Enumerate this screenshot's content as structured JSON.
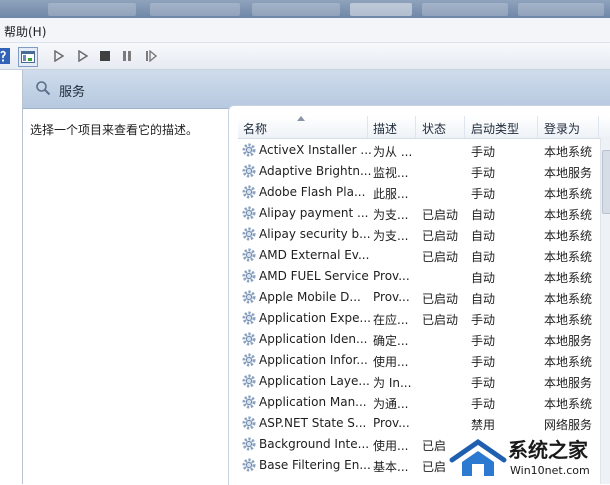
{
  "menu": {
    "help": "帮助(H)"
  },
  "header": {
    "title": "服务"
  },
  "description": "选择一个项目来查看它的描述。",
  "columns": [
    "名称",
    "描述",
    "状态",
    "启动类型",
    "登录为"
  ],
  "services": [
    {
      "name": "ActiveX Installer ...",
      "desc": "为从 ...",
      "status": "",
      "startup": "手动",
      "logon": "本地系统"
    },
    {
      "name": "Adaptive Brightn...",
      "desc": "监视...",
      "status": "",
      "startup": "手动",
      "logon": "本地服务"
    },
    {
      "name": "Adobe Flash Pla...",
      "desc": "此服...",
      "status": "",
      "startup": "手动",
      "logon": "本地系统"
    },
    {
      "name": "Alipay payment ...",
      "desc": "为支...",
      "status": "已启动",
      "startup": "自动",
      "logon": "本地系统"
    },
    {
      "name": "Alipay security b...",
      "desc": "为支...",
      "status": "已启动",
      "startup": "自动",
      "logon": "本地系统"
    },
    {
      "name": "AMD External Ev...",
      "desc": "",
      "status": "已启动",
      "startup": "自动",
      "logon": "本地系统"
    },
    {
      "name": "AMD FUEL Service",
      "desc": "Prov...",
      "status": "",
      "startup": "自动",
      "logon": "本地系统"
    },
    {
      "name": "Apple Mobile D...",
      "desc": "Prov...",
      "status": "已启动",
      "startup": "自动",
      "logon": "本地系统"
    },
    {
      "name": "Application Expe...",
      "desc": "在应...",
      "status": "已启动",
      "startup": "手动",
      "logon": "本地系统"
    },
    {
      "name": "Application Iden...",
      "desc": "确定...",
      "status": "",
      "startup": "手动",
      "logon": "本地服务"
    },
    {
      "name": "Application Infor...",
      "desc": "使用...",
      "status": "",
      "startup": "手动",
      "logon": "本地系统"
    },
    {
      "name": "Application Laye...",
      "desc": "为 In...",
      "status": "",
      "startup": "手动",
      "logon": "本地服务"
    },
    {
      "name": "Application Man...",
      "desc": "为通...",
      "status": "",
      "startup": "手动",
      "logon": "本地系统"
    },
    {
      "name": "ASP.NET State S...",
      "desc": "Prov...",
      "status": "",
      "startup": "禁用",
      "logon": "网络服务"
    },
    {
      "name": "Background Inte...",
      "desc": "使用...",
      "status": "已启",
      "startup": "",
      "logon": ""
    },
    {
      "name": "Base Filtering En...",
      "desc": "基本...",
      "status": "已启",
      "startup": "",
      "logon": ""
    }
  ],
  "watermark": {
    "brand": "系统之家",
    "site": "Win10net.com"
  },
  "colors": {
    "header_bg": "#c3d3e6",
    "gear_blue": "#5b7fae"
  }
}
